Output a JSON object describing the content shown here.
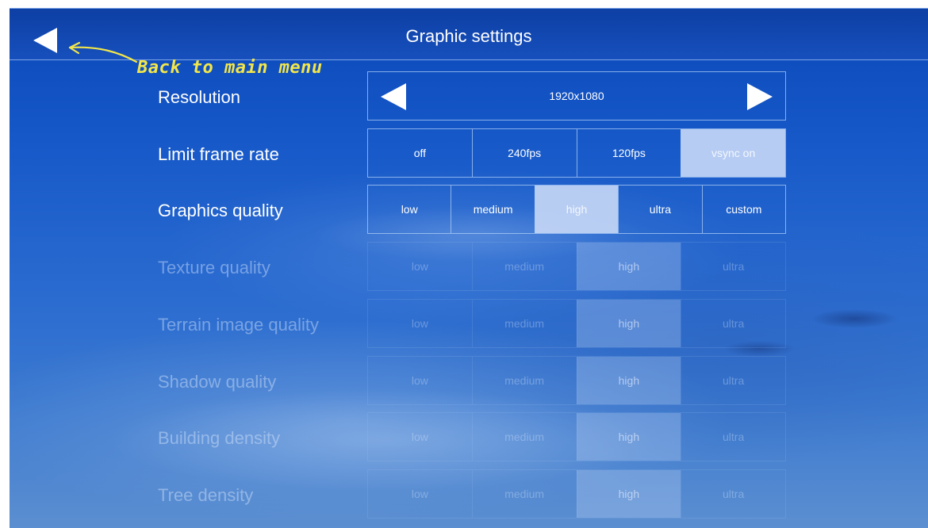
{
  "header": {
    "title": "Graphic settings",
    "back_icon": "back-arrow-icon"
  },
  "annotation": {
    "text": "Back to main menu",
    "color": "#f2e64a"
  },
  "resolution": {
    "label": "Resolution",
    "value": "1920x1080",
    "prev_icon": "triangle-left-icon",
    "next_icon": "triangle-right-icon"
  },
  "frame_rate": {
    "label": "Limit frame rate",
    "options": [
      "off",
      "240fps",
      "120fps",
      "vsync on"
    ],
    "selected": "vsync on"
  },
  "graphics_quality": {
    "label": "Graphics quality",
    "options": [
      "low",
      "medium",
      "high",
      "ultra",
      "custom"
    ],
    "selected": "high"
  },
  "texture_quality": {
    "label": "Texture quality",
    "options": [
      "low",
      "medium",
      "high",
      "ultra"
    ],
    "selected": "high",
    "enabled": false
  },
  "terrain_quality": {
    "label": "Terrain image quality",
    "options": [
      "low",
      "medium",
      "high",
      "ultra"
    ],
    "selected": "high",
    "enabled": false
  },
  "shadow_quality": {
    "label": "Shadow quality",
    "options": [
      "low",
      "medium",
      "high",
      "ultra"
    ],
    "selected": "high",
    "enabled": false
  },
  "building_density": {
    "label": "Building density",
    "options": [
      "low",
      "medium",
      "high",
      "ultra"
    ],
    "selected": "high",
    "enabled": false
  },
  "tree_density": {
    "label": "Tree density",
    "options": [
      "low",
      "medium",
      "high",
      "ultra"
    ],
    "selected": "high",
    "enabled": false
  },
  "colors": {
    "background": "#1658c8",
    "selected_segment": "#c4d6f5",
    "annotation": "#f2e64a"
  }
}
